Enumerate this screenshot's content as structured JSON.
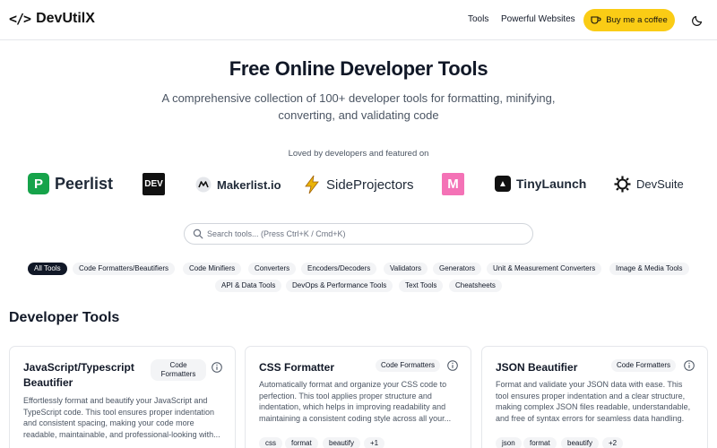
{
  "header": {
    "logo_icon": "</>",
    "logo_text": "DevUtilX",
    "nav": [
      "Tools",
      "Powerful Websites"
    ],
    "coffee_label": "Buy me a coffee",
    "accent": "#facc15"
  },
  "hero": {
    "title": "Free Online Developer Tools",
    "subtitle": "A comprehensive collection of 100+ developer tools for formatting, minifying, converting, and validating code",
    "loved": "Loved by developers and featured on"
  },
  "featured": [
    {
      "name": "Peerlist",
      "mark": "P"
    },
    {
      "name": "",
      "mark": "DEV"
    },
    {
      "name": "Makerlist.io",
      "mark": ""
    },
    {
      "name": "SideProjectors",
      "mark": ""
    },
    {
      "name": "",
      "mark": "M"
    },
    {
      "name": "TinyLaunch",
      "mark": ""
    },
    {
      "name": "DevSuite",
      "mark": ""
    }
  ],
  "search": {
    "placeholder": "Search tools... (Press Ctrl+K / Cmd+K)"
  },
  "categories": [
    "All Tools",
    "Code Formatters/Beautifiers",
    "Code Minifiers",
    "Converters",
    "Encoders/Decoders",
    "Validators",
    "Generators",
    "Unit & Measurement Converters",
    "Image & Media Tools",
    "API & Data Tools",
    "DevOps & Performance Tools",
    "Text Tools",
    "Cheatsheets"
  ],
  "section_title": "Developer Tools",
  "cards": [
    {
      "title": "JavaScript/Typescript Beautifier",
      "badge": "Code Formatters",
      "description": "Effortlessly format and beautify your JavaScript and TypeScript code. This tool ensures proper indentation and consistent spacing, making your code more readable, maintainable, and professional-looking with...",
      "tags": []
    },
    {
      "title": "CSS Formatter",
      "badge": "Code Formatters",
      "description": "Automatically format and organize your CSS code to perfection. This tool applies proper structure and indentation, which helps in improving readability and maintaining a consistent coding style across all your...",
      "tags": [
        "css",
        "format",
        "beautify",
        "+1"
      ]
    },
    {
      "title": "JSON Beautifier",
      "badge": "Code Formatters",
      "description": "Format and validate your JSON data with ease. This tool ensures proper indentation and a clear structure, making complex JSON files readable, understandable, and free of syntax errors for seamless data handling.",
      "tags": [
        "json",
        "format",
        "beautify",
        "+2"
      ]
    }
  ]
}
